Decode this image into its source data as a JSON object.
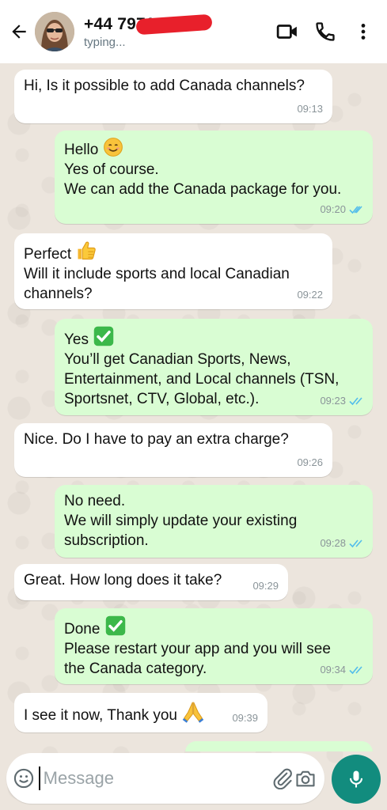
{
  "header": {
    "contact_name": "+44 7971 ",
    "status": "typing..."
  },
  "messages": [
    {
      "dir": "in",
      "text": "Hi, Is it possible to add Canada channels?",
      "time": "09:13"
    },
    {
      "dir": "out",
      "text": "Hello",
      "emoji": "smile",
      "text2": "Yes of course.\nWe can add the Canada package for you.",
      "time": "09:20"
    },
    {
      "dir": "in",
      "text": "Perfect",
      "emoji": "thumbs-up",
      "text2": "Will it include sports and local Canadian\nchannels?",
      "time": "09:22"
    },
    {
      "dir": "out",
      "text": "Yes",
      "emoji": "check",
      "text2": "You’ll get Canadian Sports, News,\nEntertainment, and Local channels (TSN,\nSportsnet, CTV, Global, etc.).",
      "time": "09:23"
    },
    {
      "dir": "in",
      "text": "Nice. Do I have to pay an extra charge?",
      "time": "09:26"
    },
    {
      "dir": "out",
      "text": "No need.\nWe will simply update your existing\nsubscription.",
      "time": "09:28"
    },
    {
      "dir": "in",
      "text": "Great. How long does it take?",
      "time": "09:29"
    },
    {
      "dir": "out",
      "text": "Done",
      "emoji": "check",
      "text2": "Please restart your app and you will see\nthe Canada category.",
      "time": "09:34"
    },
    {
      "dir": "in",
      "text": "I see it now, Thank you",
      "emoji": "pray",
      "time": "09:39"
    }
  ],
  "composer": {
    "placeholder": "Message"
  },
  "colors": {
    "header_bg": "#ffffff",
    "outgoing_bubble": "#d9fdd3",
    "incoming_bubble": "#ffffff",
    "read_tick": "#53bdeb",
    "mic_button": "#128c7e"
  }
}
